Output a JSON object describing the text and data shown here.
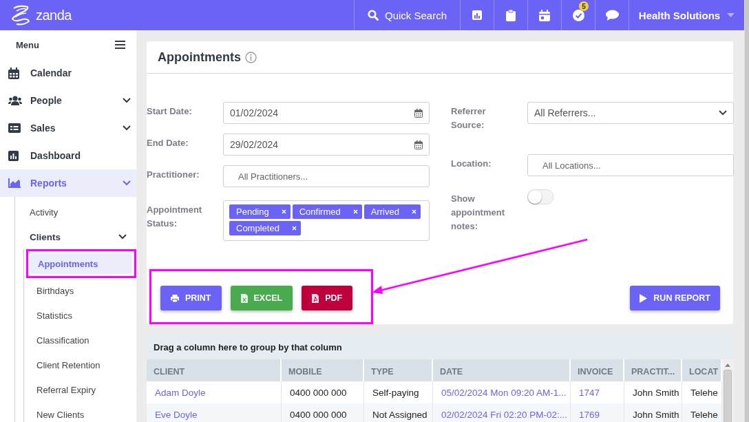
{
  "topbar": {
    "logo": "zanda",
    "search": "Quick Search",
    "icons": [
      {
        "kind": "chart"
      },
      {
        "kind": "clipboard"
      },
      {
        "kind": "calendar"
      },
      {
        "kind": "tasks",
        "badge": "5"
      },
      {
        "kind": "chat"
      }
    ],
    "account": "Health Solutions"
  },
  "sidebar": {
    "title": "Menu",
    "items": [
      {
        "label": "Calendar",
        "kind": "calendar",
        "selected": false
      },
      {
        "label": "People",
        "kind": "people",
        "selected": false,
        "submenu": true
      },
      {
        "label": "Sales",
        "kind": "sales",
        "selected": false,
        "submenu": true
      },
      {
        "label": "Dashboard",
        "kind": "dashboard",
        "selected": false
      },
      {
        "label": "Reports",
        "kind": "reports",
        "selected": true,
        "submenu": true,
        "children": [
          {
            "label": "Activity",
            "selected": false
          },
          {
            "label": "Clients",
            "selected": false,
            "submenu": true,
            "children": [
              {
                "label": "Appointments",
                "selected": true
              },
              {
                "label": "Birthdays",
                "selected": false
              },
              {
                "label": "Statistics",
                "selected": false
              },
              {
                "label": "Classification",
                "selected": false
              },
              {
                "label": "Client Retention",
                "selected": false
              },
              {
                "label": "Referral Expiry",
                "selected": false
              },
              {
                "label": "New Clients",
                "selected": false
              }
            ]
          }
        ]
      }
    ]
  },
  "report": {
    "title": "Appointments",
    "filters_left": [
      {
        "kind": "date",
        "label": "Start Date:",
        "value": "01/02/2024"
      },
      {
        "kind": "date",
        "label": "End Date:",
        "value": "29/02/2024"
      },
      {
        "kind": "input",
        "label": "Practitioner:",
        "placeholder": "All Practitioners..."
      },
      {
        "kind": "tags",
        "label": "Appointment Status:",
        "tags": [
          "Pending",
          "Confirmed",
          "Arrived",
          "Completed"
        ]
      }
    ],
    "filters_right": [
      {
        "kind": "select",
        "label": "Referrer Source:",
        "value": "All Referrers..."
      },
      {
        "kind": "input",
        "label": "Location:",
        "placeholder": "All Locations..."
      },
      {
        "kind": "toggle",
        "label": "Show appointment notes:",
        "on": false
      }
    ],
    "export_buttons": [
      {
        "kind": "print",
        "label": "PRINT"
      },
      {
        "kind": "excel",
        "label": "EXCEL"
      },
      {
        "kind": "pdf",
        "label": "PDF"
      }
    ],
    "run_button": "RUN REPORT"
  },
  "grid": {
    "group_hint": "Drag a column here to group by that column",
    "columns": [
      {
        "label": "CLIENT",
        "kind": "link"
      },
      {
        "label": "MOBILE",
        "kind": "text"
      },
      {
        "label": "TYPE",
        "kind": "text"
      },
      {
        "label": "DATE",
        "kind": "link"
      },
      {
        "label": "INVOICE",
        "kind": "link"
      },
      {
        "label": "PRACTIT...",
        "kind": "text"
      },
      {
        "label": "LOCAT",
        "kind": "text"
      }
    ],
    "rows": [
      {
        "cells": [
          "Adam Doyle",
          "0400 000 000",
          "Self-paying",
          "05/02/2024 Mon 09:20 AM-1...",
          "1747",
          "John Smith",
          "Telehe"
        ]
      },
      {
        "cells": [
          "Eve Doyle",
          "0400 000 000",
          "Not Assigned",
          "02/02/2024 Fri 02:20 PM-02:...",
          "1769",
          "John Smith",
          "Telehe"
        ]
      }
    ]
  }
}
